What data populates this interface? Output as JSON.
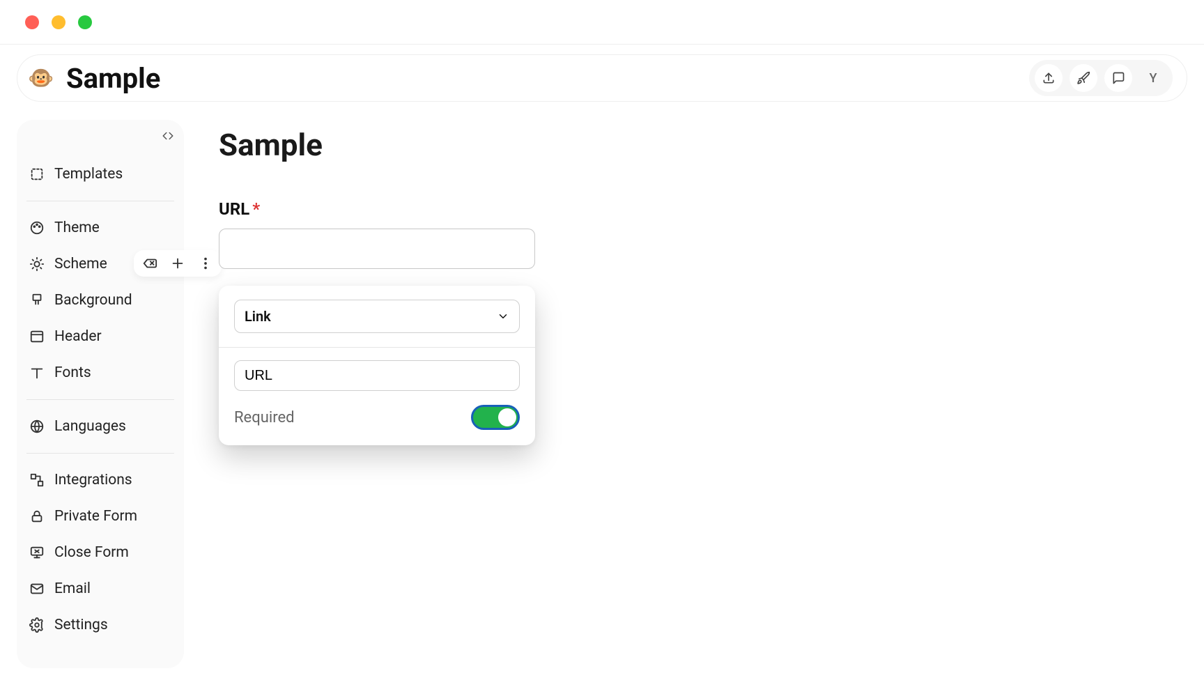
{
  "header": {
    "title": "Sample",
    "logo_emoji": "🐵",
    "avatar_letter": "Y"
  },
  "sidebar": {
    "items": [
      {
        "label": "Templates"
      },
      {
        "label": "Theme"
      },
      {
        "label": "Scheme"
      },
      {
        "label": "Background"
      },
      {
        "label": "Header"
      },
      {
        "label": "Fonts"
      },
      {
        "label": "Languages"
      },
      {
        "label": "Integrations"
      },
      {
        "label": "Private Form"
      },
      {
        "label": "Close Form"
      },
      {
        "label": "Email"
      },
      {
        "label": "Settings"
      }
    ]
  },
  "content": {
    "title": "Sample",
    "url_label": "URL",
    "url_value": ""
  },
  "popover": {
    "type_label": "Link",
    "field_value": "URL",
    "required_label": "Required",
    "required_on": true
  }
}
